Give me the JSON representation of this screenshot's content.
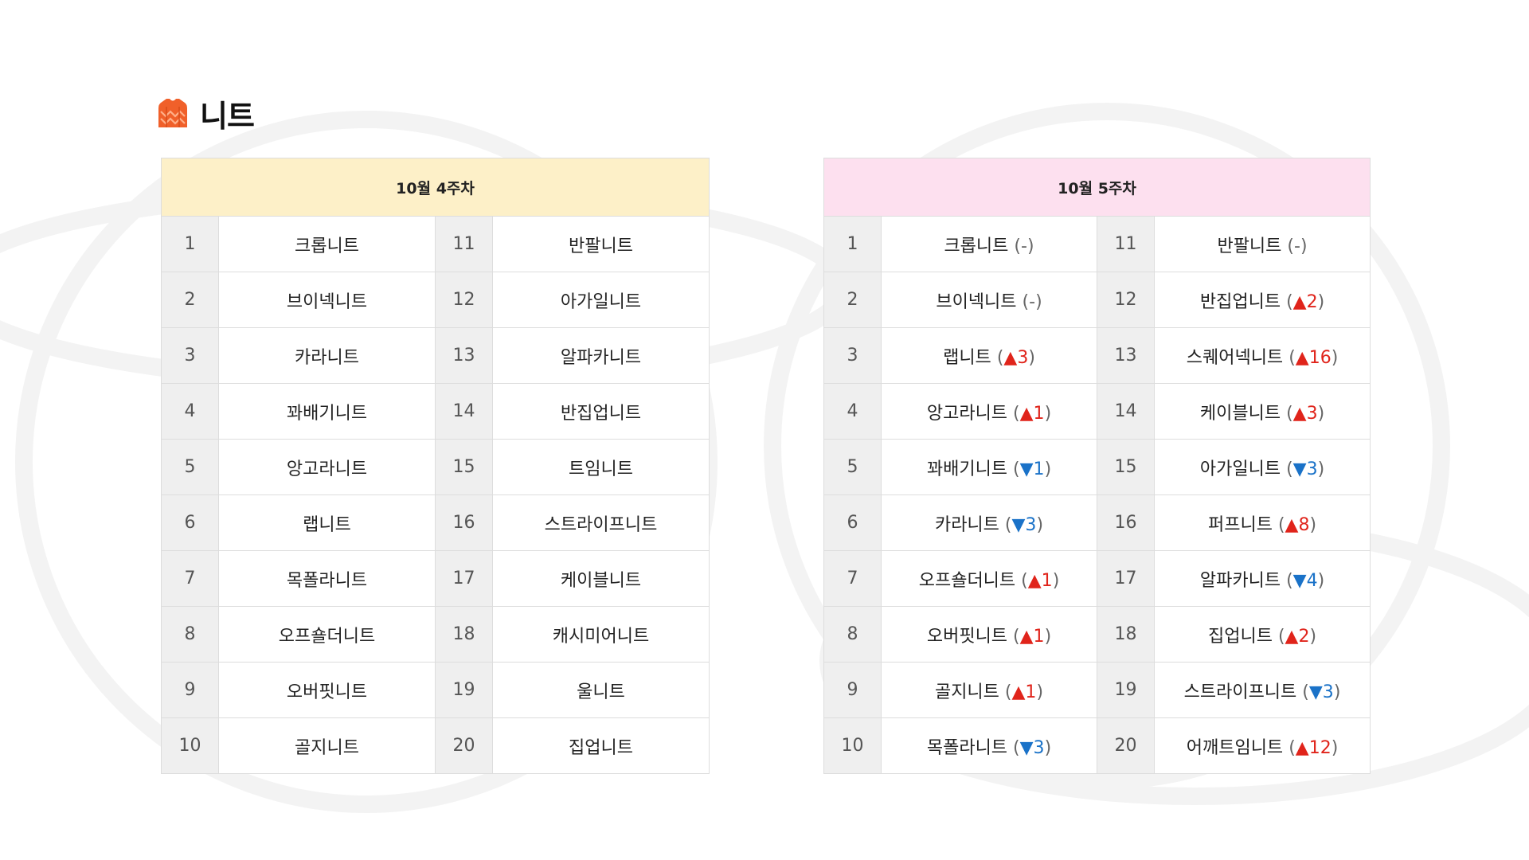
{
  "title": "니트",
  "icon": "sweater-icon",
  "colors": {
    "week4_header_bg": "#fdf0c8",
    "week5_header_bg": "#fde0ef",
    "up": "#e0241b",
    "down": "#1a72c8",
    "icon_orange": "#f0602a"
  },
  "week4": {
    "header": "10월 4주차",
    "rows": [
      {
        "rank": "1",
        "name": "크롭니트",
        "rank2": "11",
        "name2": "반팔니트"
      },
      {
        "rank": "2",
        "name": "브이넥니트",
        "rank2": "12",
        "name2": "아가일니트"
      },
      {
        "rank": "3",
        "name": "카라니트",
        "rank2": "13",
        "name2": "알파카니트"
      },
      {
        "rank": "4",
        "name": "꽈배기니트",
        "rank2": "14",
        "name2": "반집업니트"
      },
      {
        "rank": "5",
        "name": "앙고라니트",
        "rank2": "15",
        "name2": "트임니트"
      },
      {
        "rank": "6",
        "name": "랩니트",
        "rank2": "16",
        "name2": "스트라이프니트"
      },
      {
        "rank": "7",
        "name": "목폴라니트",
        "rank2": "17",
        "name2": "케이블니트"
      },
      {
        "rank": "8",
        "name": "오프숄더니트",
        "rank2": "18",
        "name2": "캐시미어니트"
      },
      {
        "rank": "9",
        "name": "오버핏니트",
        "rank2": "19",
        "name2": "울니트"
      },
      {
        "rank": "10",
        "name": "골지니트",
        "rank2": "20",
        "name2": "집업니트"
      }
    ]
  },
  "week5": {
    "header": "10월 5주차",
    "rows": [
      {
        "rank": "1",
        "name": "크롭니트",
        "change": "-",
        "dir": "flat",
        "rank2": "11",
        "name2": "반팔니트",
        "change2": "-",
        "dir2": "flat"
      },
      {
        "rank": "2",
        "name": "브이넥니트",
        "change": "-",
        "dir": "flat",
        "rank2": "12",
        "name2": "반집업니트",
        "change2": "▲2",
        "dir2": "up"
      },
      {
        "rank": "3",
        "name": "랩니트",
        "change": "▲3",
        "dir": "up",
        "rank2": "13",
        "name2": "스퀘어넥니트",
        "change2": "▲16",
        "dir2": "up"
      },
      {
        "rank": "4",
        "name": "앙고라니트",
        "change": "▲1",
        "dir": "up",
        "rank2": "14",
        "name2": "케이블니트",
        "change2": "▲3",
        "dir2": "up"
      },
      {
        "rank": "5",
        "name": "꽈배기니트",
        "change": "▼1",
        "dir": "down",
        "rank2": "15",
        "name2": "아가일니트",
        "change2": "▼3",
        "dir2": "down"
      },
      {
        "rank": "6",
        "name": "카라니트",
        "change": "▼3",
        "dir": "down",
        "rank2": "16",
        "name2": "퍼프니트",
        "change2": "▲8",
        "dir2": "up"
      },
      {
        "rank": "7",
        "name": "오프숄더니트",
        "change": "▲1",
        "dir": "up",
        "rank2": "17",
        "name2": "알파카니트",
        "change2": "▼4",
        "dir2": "down"
      },
      {
        "rank": "8",
        "name": "오버핏니트",
        "change": "▲1",
        "dir": "up",
        "rank2": "18",
        "name2": "집업니트",
        "change2": "▲2",
        "dir2": "up"
      },
      {
        "rank": "9",
        "name": "골지니트",
        "change": "▲1",
        "dir": "up",
        "rank2": "19",
        "name2": "스트라이프니트",
        "change2": "▼3",
        "dir2": "down"
      },
      {
        "rank": "10",
        "name": "목폴라니트",
        "change": "▼3",
        "dir": "down",
        "rank2": "20",
        "name2": "어깨트임니트",
        "change2": "▲12",
        "dir2": "up"
      }
    ]
  }
}
